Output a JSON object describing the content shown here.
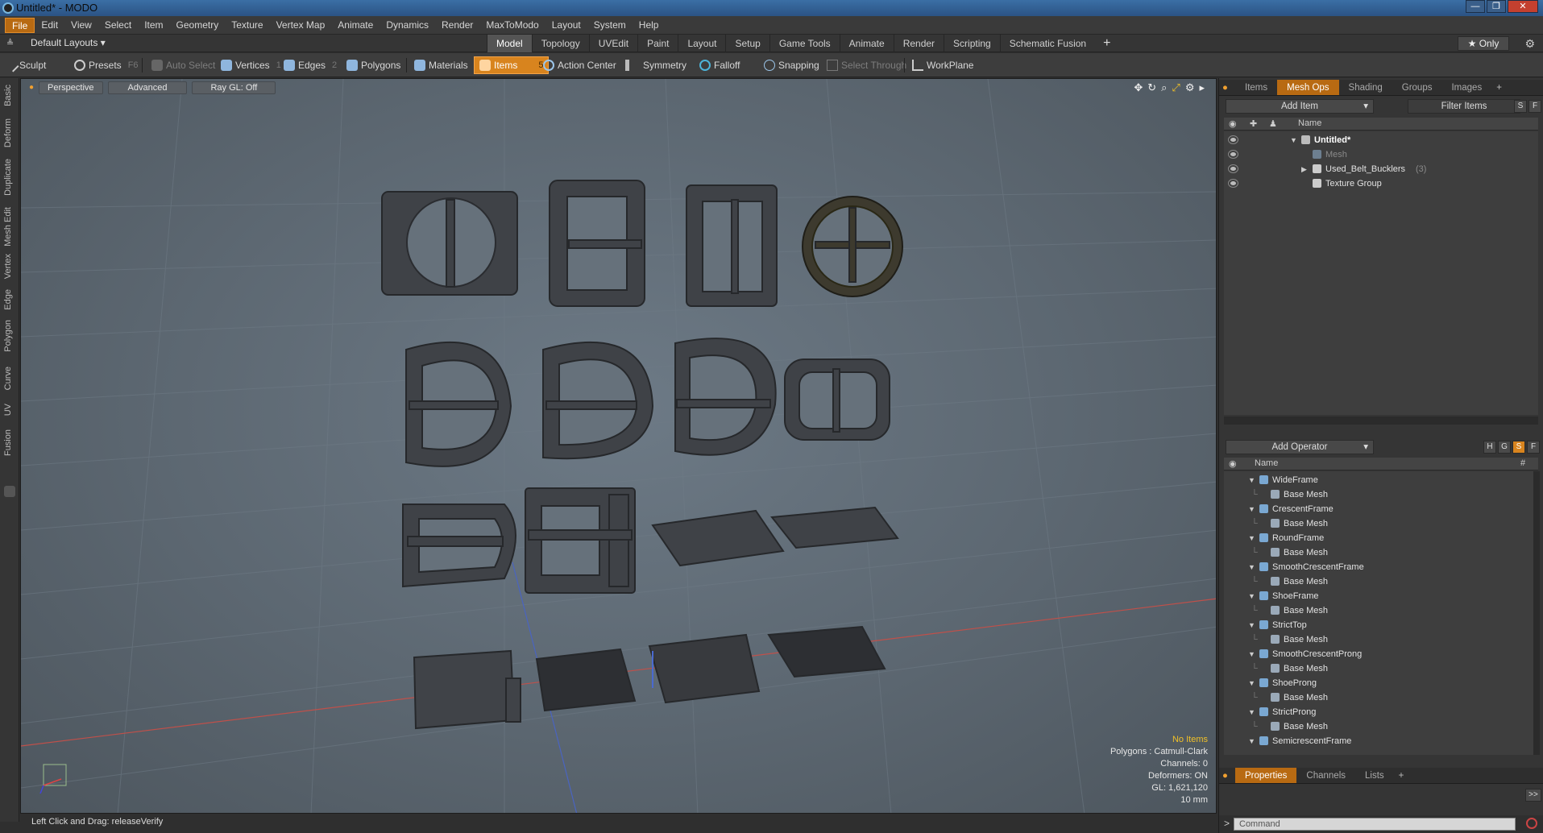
{
  "window": {
    "title": "Untitled* - MODO",
    "min": "—",
    "max": "❐",
    "close": "✕"
  },
  "menu": [
    "File",
    "Edit",
    "View",
    "Select",
    "Item",
    "Geometry",
    "Texture",
    "Vertex Map",
    "Animate",
    "Dynamics",
    "Render",
    "MaxToModo",
    "Layout",
    "System",
    "Help"
  ],
  "layouts": {
    "current": "Default Layouts ▾",
    "tabs": [
      "Model",
      "Topology",
      "UVEdit",
      "Paint",
      "Layout",
      "Setup",
      "Game Tools",
      "Animate",
      "Render",
      "Scripting",
      "Schematic Fusion"
    ],
    "active_tab": "Model",
    "plus": "+",
    "only": "★  Only"
  },
  "toolbar": {
    "sculpt": "Sculpt",
    "presets": "Presets",
    "presets_key": "F6",
    "auto_select": "Auto Select",
    "vertices": "Vertices",
    "vertices_key": "1",
    "edges": "Edges",
    "edges_key": "2",
    "polygons": "Polygons",
    "materials": "Materials",
    "items": "Items",
    "items_key": "5",
    "action_center": "Action Center",
    "symmetry": "Symmetry",
    "falloff": "Falloff",
    "snapping": "Snapping",
    "select_through": "Select Through",
    "workplane": "WorkPlane"
  },
  "left_tabs": [
    "Basic",
    "Deform",
    "Duplicate",
    "Mesh Edit",
    "Vertex",
    "Edge",
    "Polygon",
    "Curve",
    "UV",
    "Fusion"
  ],
  "viewport": {
    "perspective": "Perspective",
    "advanced": "Advanced",
    "raygl": "Ray GL: Off",
    "info": {
      "no_items": "No Items",
      "polygons": "Polygons : Catmull-Clark",
      "channels": "Channels: 0",
      "deformers": "Deformers: ON",
      "gl": "GL: 1,621,120",
      "scale": "10 mm"
    }
  },
  "status": "Left Click and Drag:   releaseVerify",
  "items_panel": {
    "tabs": [
      "Items",
      "Mesh Ops",
      "Shading",
      "Groups",
      "Images"
    ],
    "active_tab": "Mesh Ops",
    "plus": "+",
    "add_item": "Add Item",
    "filter": "Filter Items",
    "s": "S",
    "f": "F",
    "name_col": "Name",
    "rows": [
      {
        "label": "Untitled*",
        "bold": true
      },
      {
        "label": "Mesh",
        "dim": true
      },
      {
        "label": "Used_Belt_Bucklers",
        "count": "(3)"
      },
      {
        "label": "Texture Group"
      }
    ]
  },
  "ops_panel": {
    "add_operator": "Add Operator",
    "h": "H",
    "g": "G",
    "s": "S",
    "f": "F",
    "name_col": "Name",
    "hash_col": "#",
    "rows": [
      {
        "label": "WideFrame",
        "level": 0
      },
      {
        "label": "Base Mesh",
        "level": 1
      },
      {
        "label": "CrescentFrame",
        "level": 0
      },
      {
        "label": "Base Mesh",
        "level": 1
      },
      {
        "label": "RoundFrame",
        "level": 0
      },
      {
        "label": "Base Mesh",
        "level": 1
      },
      {
        "label": "SmoothCrescentFrame",
        "level": 0
      },
      {
        "label": "Base Mesh",
        "level": 1
      },
      {
        "label": "ShoeFrame",
        "level": 0
      },
      {
        "label": "Base Mesh",
        "level": 1
      },
      {
        "label": "StrictTop",
        "level": 0
      },
      {
        "label": "Base Mesh",
        "level": 1
      },
      {
        "label": "SmoothCrescentProng",
        "level": 0
      },
      {
        "label": "Base Mesh",
        "level": 1
      },
      {
        "label": "ShoeProng",
        "level": 0
      },
      {
        "label": "Base Mesh",
        "level": 1
      },
      {
        "label": "StrictProng",
        "level": 0
      },
      {
        "label": "Base Mesh",
        "level": 1
      },
      {
        "label": "SemicrescentFrame",
        "level": 0
      }
    ]
  },
  "props_panel": {
    "tabs": [
      "Properties",
      "Channels",
      "Lists"
    ],
    "active_tab": "Properties",
    "plus": "+",
    "expand": ">>"
  },
  "command": {
    "placeholder": "Command",
    "prompt": ">"
  },
  "colors": {
    "accent": "#d8841e",
    "viewport": "#5f6a74"
  }
}
